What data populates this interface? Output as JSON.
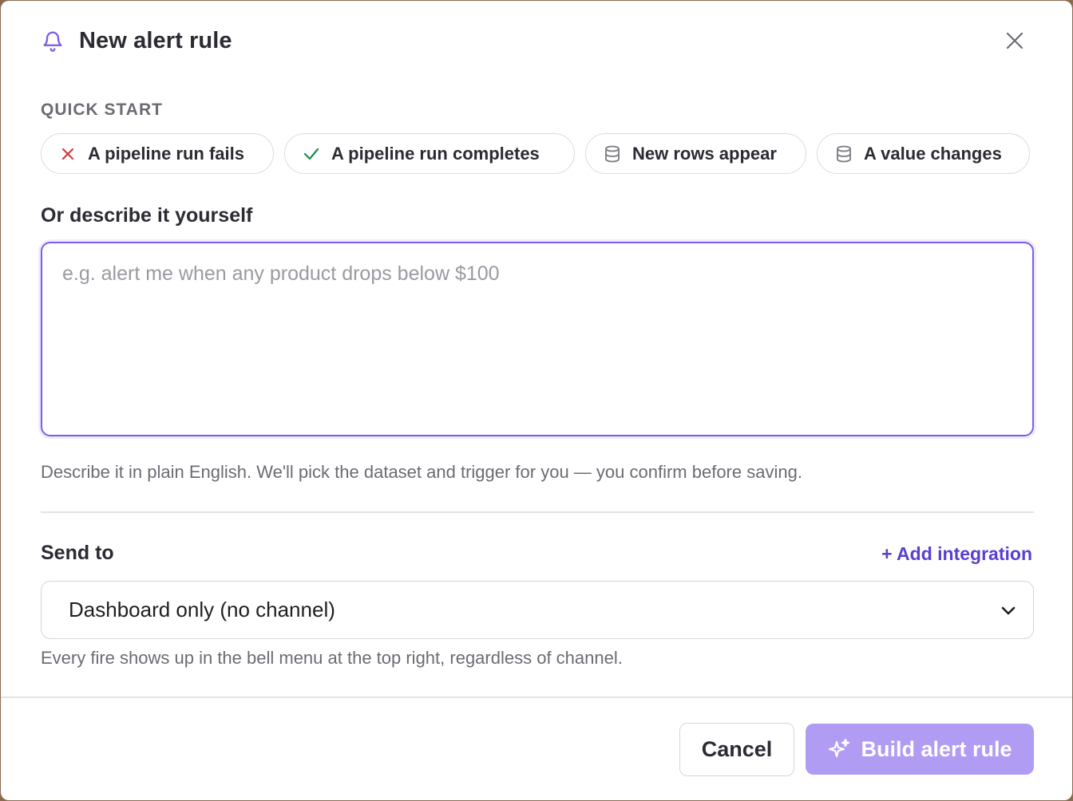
{
  "dialog": {
    "title": "New alert rule",
    "title_icon": "bell-icon",
    "close_icon": "close-icon"
  },
  "quick_start": {
    "label": "QUICK START",
    "chips": [
      {
        "label": "A pipeline run fails",
        "icon": "x-icon",
        "icon_color": "#d23a3a"
      },
      {
        "label": "A pipeline run completes",
        "icon": "check-icon",
        "icon_color": "#1f8a4c"
      },
      {
        "label": "New rows appear",
        "icon": "database-icon",
        "icon_color": "#7a7a82"
      },
      {
        "label": "A value changes",
        "icon": "database-icon",
        "icon_color": "#7a7a82"
      }
    ]
  },
  "describe": {
    "label": "Or describe it yourself",
    "placeholder": "e.g. alert me when any product drops below $100",
    "value": "",
    "hint": "Describe it in plain English. We'll pick the dataset and trigger for you — you confirm before saving."
  },
  "send_to": {
    "label": "Send to",
    "add_integration": "+ Add integration",
    "selected": "Dashboard only (no channel)",
    "hint": "Every fire shows up in the bell menu at the top right, regardless of channel."
  },
  "footer": {
    "cancel_label": "Cancel",
    "build_label": "Build alert rule",
    "build_icon": "sparkles-icon"
  },
  "colors": {
    "accent": "#7c5ce8",
    "link": "#5a3fd1",
    "primary_disabled": "#b09cf3"
  }
}
